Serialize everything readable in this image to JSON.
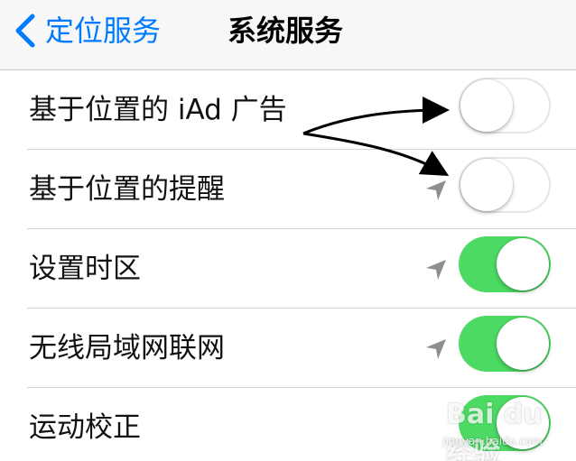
{
  "navbar": {
    "back_label": "定位服务",
    "title": "系统服务"
  },
  "rows": [
    {
      "label": "基于位置的 iAd 广告",
      "location_icon": false,
      "toggle_on": false
    },
    {
      "label": "基于位置的提醒",
      "location_icon": true,
      "toggle_on": false
    },
    {
      "label": "设置时区",
      "location_icon": true,
      "toggle_on": true
    },
    {
      "label": "无线局域网联网",
      "location_icon": true,
      "toggle_on": true
    },
    {
      "label": "运动校正",
      "location_icon": false,
      "toggle_on": true
    }
  ],
  "watermark": {
    "brand": "Bai du 经验",
    "url": "jingyan.baidu.com"
  },
  "colors": {
    "accent": "#007aff",
    "toggle_on": "#4cd964",
    "location_arrow": "#8e8e93"
  }
}
